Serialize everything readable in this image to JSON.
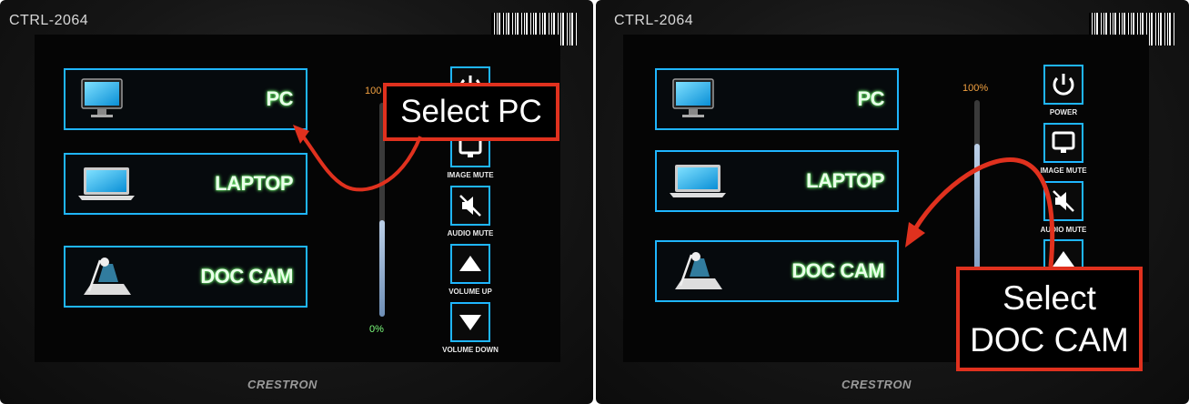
{
  "left": {
    "device_label": "CTRL-2064",
    "sources": [
      {
        "label": "PC",
        "icon": "monitor-icon"
      },
      {
        "label": "LAPTOP",
        "icon": "laptop-icon"
      },
      {
        "label": "DOC CAM",
        "icon": "document-camera-icon"
      }
    ],
    "controls": [
      {
        "label": "",
        "icon": "power-icon"
      },
      {
        "label": "IMAGE MUTE",
        "icon": "monitor-icon"
      },
      {
        "label": "AUDIO MUTE",
        "icon": "speaker-mute-icon"
      },
      {
        "label": "VOLUME UP",
        "icon": "triangle-up-icon"
      },
      {
        "label": "VOLUME DOWN",
        "icon": "triangle-down-icon"
      }
    ],
    "volume": {
      "top_label": "100",
      "bottom_label": "0%",
      "level": 0.45
    },
    "brand": "CRESTRON",
    "callout": "Select PC"
  },
  "right": {
    "device_label": "CTRL-2064",
    "sources": [
      {
        "label": "PC",
        "icon": "monitor-icon"
      },
      {
        "label": "LAPTOP",
        "icon": "laptop-icon"
      },
      {
        "label": "DOC CAM",
        "icon": "document-camera-icon"
      }
    ],
    "controls": [
      {
        "label": "POWER",
        "icon": "power-icon"
      },
      {
        "label": "IMAGE MUTE",
        "icon": "monitor-icon"
      },
      {
        "label": "AUDIO MUTE",
        "icon": "speaker-mute-icon"
      }
    ],
    "volume": {
      "top_label": "100%",
      "level": 0.8
    },
    "brand": "CRESTRON",
    "callout_line1": "Select",
    "callout_line2": "DOC CAM"
  },
  "colors": {
    "accent": "#1fb6ff",
    "callout_border": "#e0311e",
    "label_glow": "#7dff7d",
    "percent_top": "#f0a040"
  }
}
